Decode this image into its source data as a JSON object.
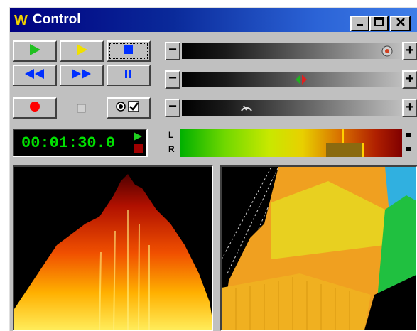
{
  "window": {
    "logo_text": "W",
    "title": "Control",
    "buttons": {
      "minimize": "_",
      "maximize": "□",
      "close": "×"
    }
  },
  "transport": {
    "play": "play",
    "play_selection": "play-selection",
    "stop": "stop",
    "rewind": "rewind",
    "fast_forward": "fast-forward",
    "pause": "pause",
    "record": "record",
    "loop": "loop"
  },
  "sliders": [
    {
      "name": "volume",
      "minus": "−",
      "plus": "+",
      "level": 0.97,
      "thumb_icon": "volume-knob-icon"
    },
    {
      "name": "balance",
      "minus": "−",
      "plus": "+",
      "level": 0.55,
      "thumb_icon": "balance-icon"
    },
    {
      "name": "speed",
      "minus": "−",
      "plus": "+",
      "level": 0.28,
      "thumb_icon": "speed-icon"
    }
  ],
  "time_display": "00:01:30.0",
  "vu_meter": {
    "left_label": "L",
    "right_label": "R",
    "left_level": 0.72,
    "right_level": 0.84
  },
  "colors": {
    "time_text": "#00e000",
    "title_bar": "#000080"
  }
}
